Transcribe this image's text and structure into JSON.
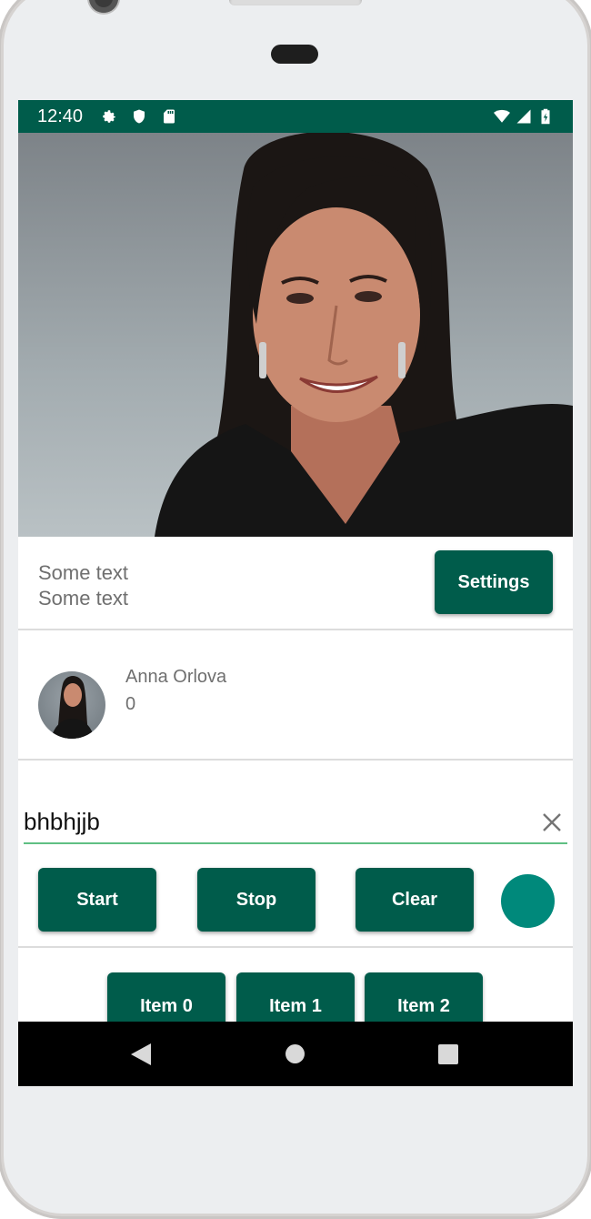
{
  "status_bar": {
    "time": "12:40",
    "icons": [
      "settings-icon",
      "shield-icon",
      "sd-card-icon",
      "wifi-icon",
      "signal-icon",
      "battery-icon"
    ]
  },
  "info": {
    "line1": "Some text",
    "line2": "Some text",
    "settings_label": "Settings"
  },
  "contact": {
    "name": "Anna Orlova",
    "count": "0"
  },
  "search": {
    "value": "bhbhjjb"
  },
  "actions": {
    "start_label": "Start",
    "stop_label": "Stop",
    "clear_label": "Clear"
  },
  "items": [
    {
      "label": "Item 0"
    },
    {
      "label": "Item 1"
    },
    {
      "label": "Item 2"
    }
  ],
  "nav": {
    "icons": [
      "back-icon",
      "home-icon",
      "recents-icon"
    ]
  },
  "colors": {
    "primary": "#005c4b",
    "fab": "#00897b",
    "underline": "#5fbf83"
  }
}
